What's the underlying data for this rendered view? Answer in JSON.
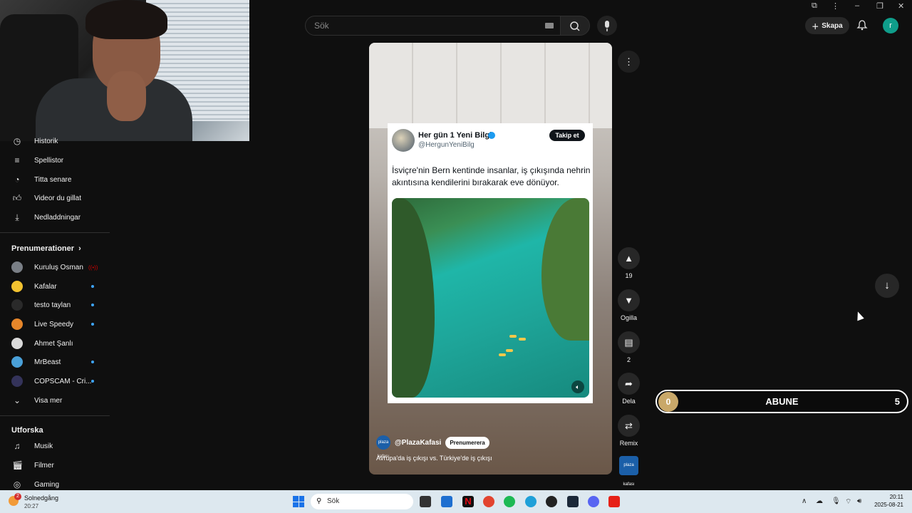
{
  "topbar": {
    "search_placeholder": "Sök",
    "create_label": "Skapa",
    "avatar_letter": "r"
  },
  "sidebar": {
    "you_items": [
      {
        "label": "Historik",
        "icon": "history-icon"
      },
      {
        "label": "Spellistor",
        "icon": "playlist-icon"
      },
      {
        "label": "Titta senare",
        "icon": "clock-icon"
      },
      {
        "label": "Videor du gillat",
        "icon": "thumb-up-icon"
      },
      {
        "label": "Nedladdningar",
        "icon": "download-icon"
      }
    ],
    "subscriptions_title": "Prenumerationer",
    "subscriptions": [
      {
        "label": "Kuruluş Osman",
        "status": "live"
      },
      {
        "label": "Kafalar",
        "status": "new"
      },
      {
        "label": "testo taylan",
        "status": "new"
      },
      {
        "label": "Live Speedy",
        "status": "new"
      },
      {
        "label": "Ahmet Şanlı",
        "status": "none"
      },
      {
        "label": "MrBeast",
        "status": "new"
      },
      {
        "label": "COPSCAM - Cri...",
        "status": "new"
      }
    ],
    "show_more": "Visa mer",
    "explore_title": "Utforska",
    "explore": [
      {
        "label": "Musik",
        "icon": "music-icon"
      },
      {
        "label": "Filmer",
        "icon": "film-icon"
      },
      {
        "label": "Gaming",
        "icon": "gaming-icon"
      }
    ]
  },
  "short": {
    "tweet_author": "Her gün 1 Yeni Bilgi",
    "tweet_handle": "@HergunYeniBilg",
    "tweet_follow": "Takip et",
    "tweet_text": "İsviçre'nin Bern kentinde insanlar, iş çıkışında nehrin akıntısına kendilerini bırakarak eve dönüyor.",
    "channel": "@PlazaKafasi",
    "channel_avatar_text": "plaza kafası",
    "subscribe": "Prenumerera",
    "title": "Avrupa'da iş çıkışı vs. Türkiye'de iş çıkışı"
  },
  "actions": {
    "like_count": "19",
    "dislike_label": "Ogilla",
    "comment_count": "2",
    "share_label": "Dela",
    "remix_label": "Remix"
  },
  "abune_widget": {
    "current": "0",
    "label": "ABUNE",
    "goal": "5",
    "progress": 0
  },
  "taskbar": {
    "weather_title": "Solnedgång",
    "weather_time": "20:27",
    "weather_badge": "2",
    "search": "Sök",
    "time": "20:11",
    "date": "2025-08-21"
  },
  "colors": {
    "background": "#0f0f0f",
    "accent_blue": "#3ea6ff",
    "abune_badge": "#c9a869",
    "taskbar": "#dde8ef"
  }
}
